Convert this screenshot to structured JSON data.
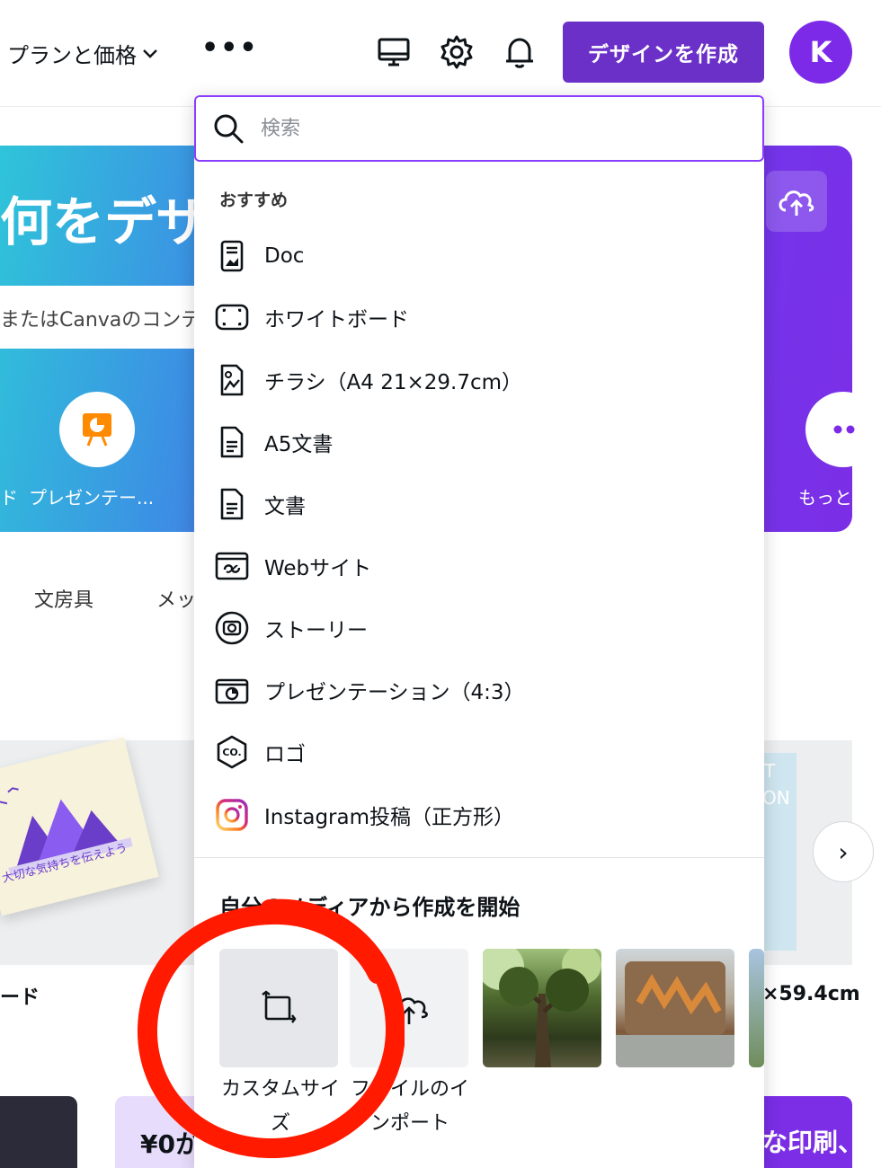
{
  "header": {
    "plan_label": "プランと価格",
    "create_button": "デザインを作成",
    "avatar_initial": "K"
  },
  "hero": {
    "title": "何をデザ",
    "subtitle": "またはCanvaのコンテ",
    "categories": {
      "left_fragment": "ド",
      "presentation": "プレゼンテー...",
      "more": "もっと"
    }
  },
  "background": {
    "tabs": [
      "文房具",
      "メッ"
    ],
    "card_left_text": "大切な気持ちを伝えよう",
    "card_left_label": "ード",
    "card_right_label": "×59.4cm",
    "poster_text": [
      "T",
      "ON"
    ],
    "bottom_left_price": "¥0か",
    "bottom_right_text": "な印刷、"
  },
  "dropdown": {
    "search_placeholder": "検索",
    "recommended_title": "おすすめ",
    "items": [
      {
        "label": "Doc",
        "icon": "doc-icon"
      },
      {
        "label": "ホワイトボード",
        "icon": "whiteboard-icon"
      },
      {
        "label": "チラシ（A4 21×29.7cm）",
        "icon": "flyer-icon"
      },
      {
        "label": "A5文書",
        "icon": "document-icon"
      },
      {
        "label": "文書",
        "icon": "document-icon"
      },
      {
        "label": "Webサイト",
        "icon": "website-icon"
      },
      {
        "label": "ストーリー",
        "icon": "story-icon"
      },
      {
        "label": "プレゼンテーション（4:3）",
        "icon": "presentation-icon"
      },
      {
        "label": "ロゴ",
        "icon": "logo-icon"
      },
      {
        "label": "Instagram投稿（正方形）",
        "icon": "instagram-icon"
      }
    ],
    "media_title": "自分のメディアから作成を開始",
    "tiles": [
      {
        "label": "カスタムサイズ",
        "icon": "custom-size-icon"
      },
      {
        "label": "ファイルのインポート",
        "icon": "upload-cloud-icon"
      }
    ]
  },
  "colors": {
    "brand_purple": "#6b30c8",
    "avatar_purple": "#7d2ae8",
    "search_border": "#8b3dff",
    "annotation_red": "#ff1a00"
  }
}
